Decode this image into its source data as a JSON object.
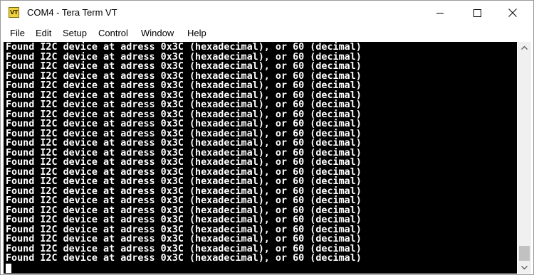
{
  "window": {
    "title": "COM4 - Tera Term VT",
    "icon_label": "VT",
    "icon_name": "tera-term-app-icon",
    "buttons": [
      "minimize-icon",
      "maximize-icon",
      "close-icon"
    ]
  },
  "menu": {
    "items": [
      {
        "label": "File"
      },
      {
        "label": "Edit"
      },
      {
        "label": "Setup"
      },
      {
        "label": "Control"
      },
      {
        "label": "Window"
      },
      {
        "label": "Help"
      }
    ]
  },
  "terminal": {
    "background": "#000000",
    "foreground": "#ffffff",
    "lines": [
      "Found I2C device at adress 0x3C (hexadecimal), or 60 (decimal)",
      "Found I2C device at adress 0x3C (hexadecimal), or 60 (decimal)",
      "Found I2C device at adress 0x3C (hexadecimal), or 60 (decimal)",
      "Found I2C device at adress 0x3C (hexadecimal), or 60 (decimal)",
      "Found I2C device at adress 0x3C (hexadecimal), or 60 (decimal)",
      "Found I2C device at adress 0x3C (hexadecimal), or 60 (decimal)",
      "Found I2C device at adress 0x3C (hexadecimal), or 60 (decimal)",
      "Found I2C device at adress 0x3C (hexadecimal), or 60 (decimal)",
      "Found I2C device at adress 0x3C (hexadecimal), or 60 (decimal)",
      "Found I2C device at adress 0x3C (hexadecimal), or 60 (decimal)",
      "Found I2C device at adress 0x3C (hexadecimal), or 60 (decimal)",
      "Found I2C device at adress 0x3C (hexadecimal), or 60 (decimal)",
      "Found I2C device at adress 0x3C (hexadecimal), or 60 (decimal)",
      "Found I2C device at adress 0x3C (hexadecimal), or 60 (decimal)",
      "Found I2C device at adress 0x3C (hexadecimal), or 60 (decimal)",
      "Found I2C device at adress 0x3C (hexadecimal), or 60 (decimal)",
      "Found I2C device at adress 0x3C (hexadecimal), or 60 (decimal)",
      "Found I2C device at adress 0x3C (hexadecimal), or 60 (decimal)",
      "Found I2C device at adress 0x3C (hexadecimal), or 60 (decimal)",
      "Found I2C device at adress 0x3C (hexadecimal), or 60 (decimal)",
      "Found I2C device at adress 0x3C (hexadecimal), or 60 (decimal)",
      "Found I2C device at adress 0x3C (hexadecimal), or 60 (decimal)",
      "Found I2C device at adress 0x3C (hexadecimal), or 60 (decimal)"
    ]
  },
  "scrollbar": {
    "position": 1.0,
    "up_icon": "scroll-up-arrow-icon",
    "down_icon": "scroll-down-arrow-icon"
  }
}
